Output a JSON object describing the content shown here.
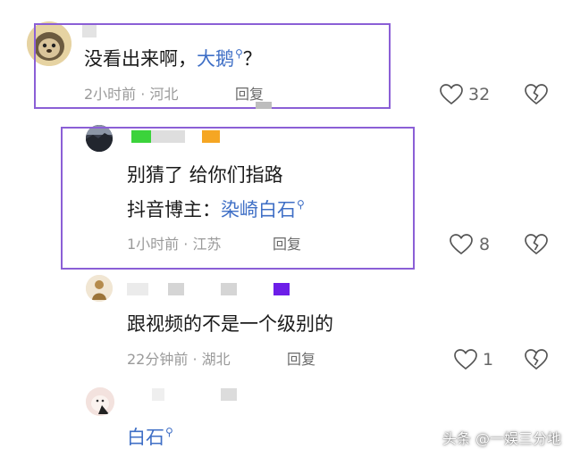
{
  "comments": [
    {
      "text": "没看出来啊，",
      "link": "大鹅",
      "suffix": "？",
      "time": "2小时前 · 河北",
      "reply": "回复",
      "likes": "32"
    },
    {
      "line1": "别猜了 给你们指路",
      "line2_prefix": "抖音博主：",
      "line2_link": "染崎白石",
      "time": "1小时前 · 江苏",
      "reply": "回复",
      "likes": "8"
    },
    {
      "text": "跟视频的不是一个级别的",
      "time": "22分钟前 · 湖北",
      "reply": "回复",
      "likes": "1"
    },
    {
      "link": "白石"
    }
  ],
  "watermark": "头条 @一娱三分地",
  "colors": {
    "highlight_border": "#8b5fd6",
    "link": "#3f6fc6",
    "meta": "#9a9a9a",
    "badge_green": "#3bd33b",
    "badge_orange": "#f5a623",
    "badge_purple": "#6d1ee8"
  },
  "icons": [
    "search-icon",
    "heart-icon",
    "broken-heart-icon"
  ]
}
